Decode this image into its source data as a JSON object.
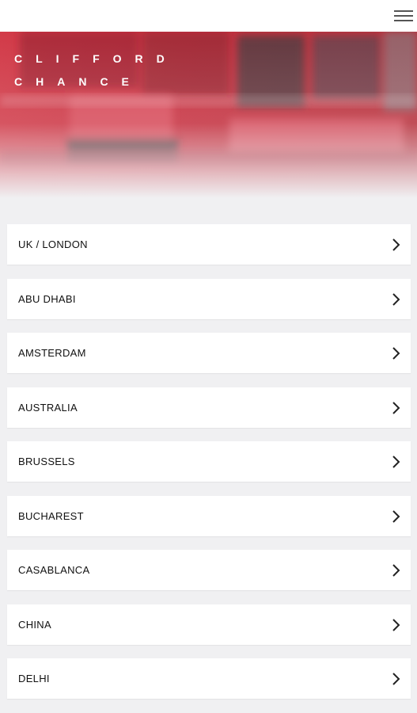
{
  "header": {
    "menu_icon": "hamburger-menu-icon"
  },
  "hero": {
    "logo_line1": "CLIFFORD",
    "logo_line2": "CHANCE",
    "colors": {
      "red": "#c23a45",
      "white": "#ffffff"
    }
  },
  "locations": [
    {
      "label": "UK / LONDON"
    },
    {
      "label": "ABU DHABI"
    },
    {
      "label": "AMSTERDAM"
    },
    {
      "label": "AUSTRALIA"
    },
    {
      "label": "BRUSSELS"
    },
    {
      "label": "BUCHAREST"
    },
    {
      "label": "CASABLANCA"
    },
    {
      "label": "CHINA"
    },
    {
      "label": "DELHI"
    }
  ],
  "item_icon": "chevron-right-icon"
}
